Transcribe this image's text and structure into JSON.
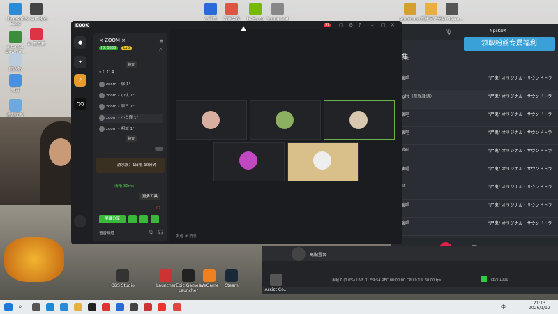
{
  "desktop_icons": [
    {
      "label": "Microsoft Edge",
      "color": "#2b8bd6"
    },
    {
      "label": "Internet Downlo...",
      "color": "#3c8e3c"
    },
    {
      "label": "回收站",
      "color": "#bcd"
    },
    {
      "label": "迅雷",
      "color": "#4a90e2"
    },
    {
      "label": "控制面板",
      "color": "#6fa8dc"
    },
    {
      "label": "Smart Bob",
      "color": "#444"
    },
    {
      "label": "AI 工具箱",
      "color": "#d34"
    }
  ],
  "top_icons": [
    {
      "label": "小蓝盒",
      "color": "#2a6bd8"
    },
    {
      "label": "腾讯会议",
      "color": "#d54"
    },
    {
      "label": "GeForce Experience",
      "color": "#76b900"
    },
    {
      "label": "Young and Beautiful",
      "color": "#888"
    },
    {
      "label": "admin.nvr",
      "color": "#d4a030"
    },
    {
      "label": "新建文件夹",
      "color": "#e8b040"
    },
    {
      "label": "AirPlayer...",
      "color": "#555"
    }
  ],
  "bottom_icons": [
    {
      "label": "OBS Studio",
      "color": "#333"
    },
    {
      "label": "Launcher",
      "color": "#c33"
    },
    {
      "label": "Epic Games Launcher",
      "color": "#222"
    },
    {
      "label": "WeGame",
      "color": "#f08020"
    },
    {
      "label": "Steam",
      "color": "#1b2838"
    },
    {
      "label": "Assist Ce...",
      "color": "#555"
    }
  ],
  "music": {
    "user": "NpcKUX",
    "banner": "领取粉丝专属福利",
    "title_fragment": "集",
    "rows": [
      {
        "left": "演唱",
        "right": "\"尸鬼\" オリジナル・サウンドトラ"
      },
      {
        "left": "ight（夜视律诗）",
        "right": "\"尸鬼\" オリジナル・サウンドトラ"
      },
      {
        "left": "演唱",
        "right": "\"尸鬼\" オリジナル・サウンドトラ"
      },
      {
        "left": "演唱",
        "right": "\"尸鬼\" オリジナル・サウンドトラ"
      },
      {
        "left": "ster",
        "right": "\"尸鬼\" オリジナル・サウンドトラ"
      },
      {
        "left": "演唱",
        "right": "\"尸鬼\" オリジナル・サウンドトラ"
      },
      {
        "left": "nt",
        "right": "\"尸鬼\" オリジナル・サウンドトラ"
      },
      {
        "left": "演唱",
        "right": "\"尸鬼\" オリジナル・サウンドトラ"
      },
      {
        "left": "演唱",
        "right": "\"尸鬼\" オリジナル・サウンドトラ"
      }
    ]
  },
  "kook": {
    "logo": "KOOK",
    "server_name": "× ZOOM ×",
    "badge_id": "ID: 5550",
    "badge_lv": "Lv8",
    "channel": "⭑ C C ⊕",
    "members": [
      "zoom • 徐 1°",
      "zoom • 小优 1°",
      "zoom • 李三 1°",
      "zoom • 小白鹿 1°",
      "zoom • 祖城 1°"
    ],
    "tooltip1": "静音",
    "tooltip2": "静音",
    "hint": "游水族：1日限 10分钟",
    "quality": "清晰 30ms",
    "btn_more": "更多工具",
    "btn_share": "屏幕分享",
    "bottom_label": "语音频道",
    "chat_placeholder": "发送 # 消息...",
    "notif": "99"
  },
  "taskbar": {
    "time": "21:13",
    "date": "2026/1/12",
    "lang": "中"
  },
  "obs": {
    "label": "高配置台",
    "status": "丢帧 0 (0.0%)  LIVE 01:59:54  REC 00:00:00  CPU 0.1%  60.00 fps",
    "bitrate": "kb/s  1000"
  }
}
